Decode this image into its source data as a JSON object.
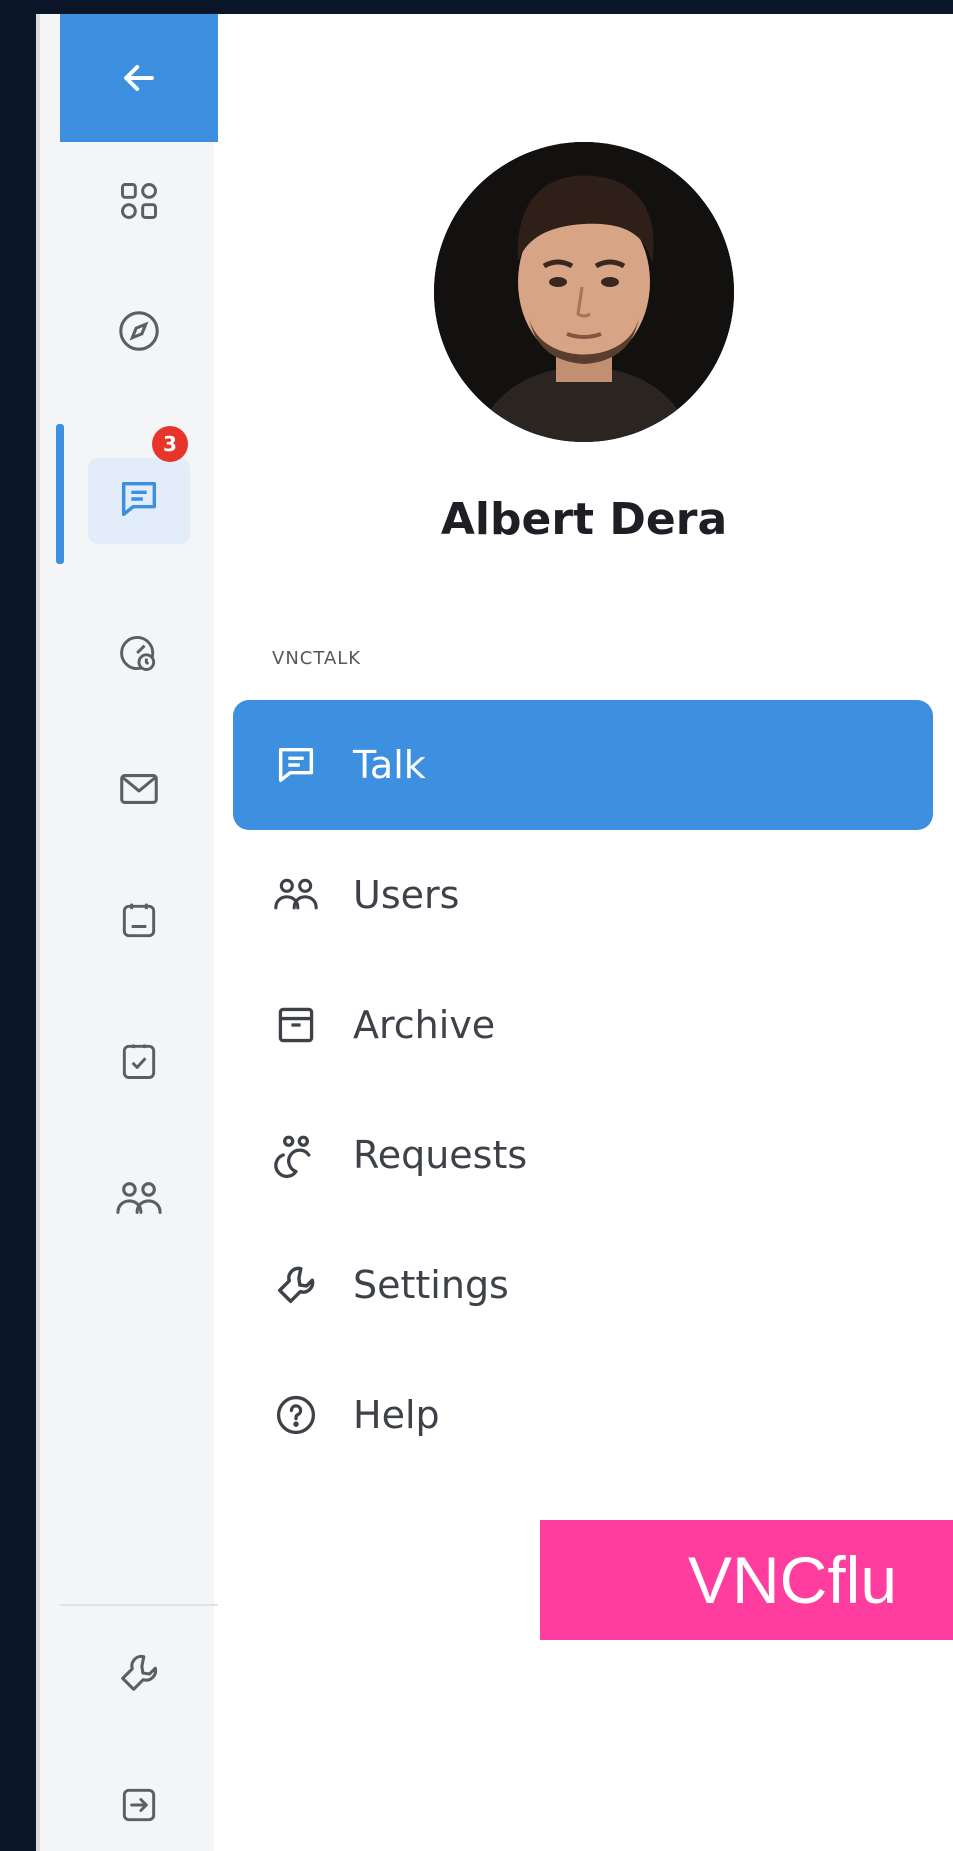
{
  "user": {
    "name": "Albert Dera"
  },
  "rail": {
    "items": [
      {
        "icon": "apps-grid-icon"
      },
      {
        "icon": "compass-icon"
      },
      {
        "icon": "chat-icon",
        "badge": "3",
        "active": true
      },
      {
        "icon": "dashboard-gauge-icon"
      },
      {
        "icon": "mail-icon"
      },
      {
        "icon": "calendar-icon"
      },
      {
        "icon": "task-check-icon"
      },
      {
        "icon": "people-icon"
      }
    ],
    "bottom": [
      {
        "icon": "wrench-icon"
      },
      {
        "icon": "logout-icon"
      }
    ]
  },
  "section": {
    "label": "VNCTALK"
  },
  "menu": [
    {
      "label": "Talk",
      "icon": "chat-icon",
      "active": true
    },
    {
      "label": "Users",
      "icon": "users-icon"
    },
    {
      "label": "Archive",
      "icon": "archive-icon"
    },
    {
      "label": "Requests",
      "icon": "requests-icon"
    },
    {
      "label": "Settings",
      "icon": "wrench-icon"
    },
    {
      "label": "Help",
      "icon": "help-circle-icon"
    }
  ],
  "promo": {
    "text": "VNCflu"
  },
  "colors": {
    "accent": "#3d8fe0",
    "badge": "#e8352b",
    "promo": "#ff3d9e",
    "frame": "#0b1528"
  }
}
